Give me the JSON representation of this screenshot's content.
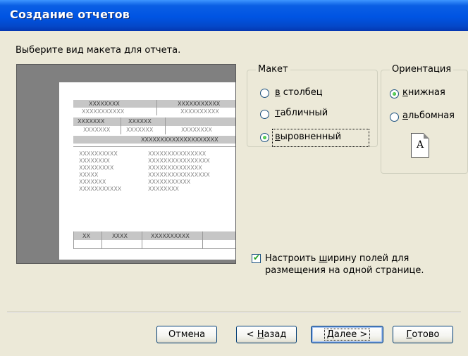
{
  "window": {
    "title": "Создание отчетов"
  },
  "prompt": "Выберите вид макета для отчета.",
  "preview": {
    "header_row1": [
      "XXXXXXXX",
      "XXXXXXXXXXX"
    ],
    "header_row2": [
      "XXXXXXXXXXX",
      "XXXXXXXXXX"
    ],
    "group_row1": [
      "XXXXXXX",
      "XXXXXX"
    ],
    "group_row2": [
      "XXXXXXX",
      "XXXXXXX",
      "XXXXXXXX"
    ],
    "group_bar": "XXXXXXXXXXXXXXXXXXXX",
    "detail_left": [
      "XXXXXXXXXX",
      "XXXXXXXX",
      "XXXXXXXXX",
      "XXXXX",
      "XXXXXXX",
      "XXXXXXXXXXX"
    ],
    "detail_right": [
      "XXXXXXXXXXXXXXX",
      "XXXXXXXXXXXXXXXX",
      "XXXXXXXXXXXXXX",
      "XXXXXXXXXXXXXXXX",
      "XXXXXXXXXXX",
      "XXXXXXXX"
    ],
    "footer_row": [
      "XX",
      "XXXX",
      "XXXXXXXXXX"
    ]
  },
  "layout_group": {
    "legend": "Макет",
    "options": [
      {
        "mnemonic": "в",
        "rest": " столбец",
        "checked": false
      },
      {
        "mnemonic": "т",
        "rest": "абличный",
        "checked": false
      },
      {
        "mnemonic": "в",
        "rest": "ыровненный",
        "checked": true
      }
    ]
  },
  "orientation_group": {
    "legend": "Ориентация",
    "options": [
      {
        "mnemonic": "к",
        "rest": "нижная",
        "checked": true
      },
      {
        "mnemonic": "а",
        "rest": "льбомная",
        "checked": false
      }
    ],
    "page_icon_letter": "A"
  },
  "fit_checkbox": {
    "checked": true,
    "line1_pre": "Настроить ",
    "line1_mn": "ш",
    "line1_post": "ирину полей для",
    "line2": "размещения на одной странице."
  },
  "buttons": {
    "cancel": "Отмена",
    "back_pre": "< ",
    "back_mn": "Н",
    "back_post": "азад",
    "next_mn": "Д",
    "next_post": "алее >",
    "finish_mn": "Г",
    "finish_post": "отово"
  },
  "colors": {
    "titlebar": "#0054E3",
    "dialog_bg": "#ECE9D8",
    "radio_dot": "#22A022"
  }
}
